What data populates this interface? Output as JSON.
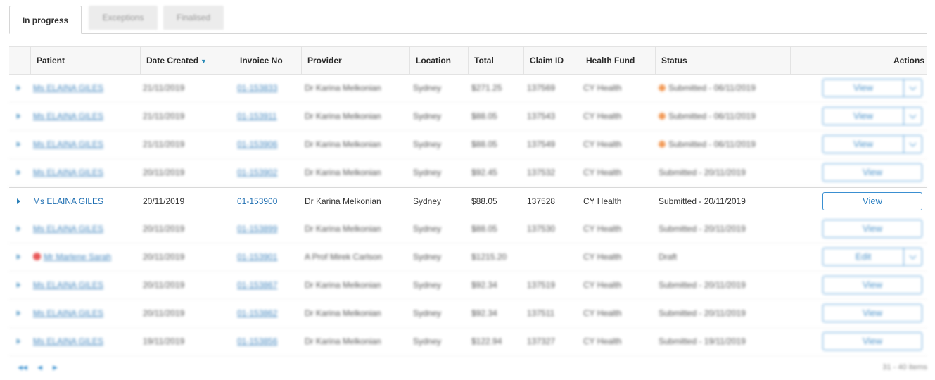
{
  "tabs": [
    {
      "label": "In progress",
      "active": true
    },
    {
      "label": "Exceptions",
      "active": false
    },
    {
      "label": "Finalised",
      "active": false
    }
  ],
  "columns": {
    "patient": "Patient",
    "date_created": "Date Created",
    "invoice_no": "Invoice No",
    "provider": "Provider",
    "location": "Location",
    "total": "Total",
    "claim_id": "Claim ID",
    "health_fund": "Health Fund",
    "status": "Status",
    "actions": "Actions"
  },
  "sort": {
    "column": "date_created",
    "direction": "descending"
  },
  "rows": [
    {
      "patient": "Ms ELAINA GILES",
      "date": "21/11/2019",
      "invoice": "01-153833",
      "provider": "Dr Karina Melkonian",
      "location": "Sydney",
      "total": "$271.25",
      "claim": "137569",
      "fund": "CY Health",
      "status": "Submitted - 06/11/2019",
      "status_dot": "orange",
      "patient_dot": "",
      "action": "View",
      "has_split": true,
      "blurred": true
    },
    {
      "patient": "Ms ELAINA GILES",
      "date": "21/11/2019",
      "invoice": "01-153911",
      "provider": "Dr Karina Melkonian",
      "location": "Sydney",
      "total": "$88.05",
      "claim": "137543",
      "fund": "CY Health",
      "status": "Submitted - 06/11/2019",
      "status_dot": "orange",
      "patient_dot": "",
      "action": "View",
      "has_split": true,
      "blurred": true
    },
    {
      "patient": "Ms ELAINA GILES",
      "date": "21/11/2019",
      "invoice": "01-153906",
      "provider": "Dr Karina Melkonian",
      "location": "Sydney",
      "total": "$88.05",
      "claim": "137549",
      "fund": "CY Health",
      "status": "Submitted - 06/11/2019",
      "status_dot": "orange",
      "patient_dot": "",
      "action": "View",
      "has_split": true,
      "blurred": true
    },
    {
      "patient": "Ms ELAINA GILES",
      "date": "20/11/2019",
      "invoice": "01-153902",
      "provider": "Dr Karina Melkonian",
      "location": "Sydney",
      "total": "$92.45",
      "claim": "137532",
      "fund": "CY Health",
      "status": "Submitted - 20/11/2019",
      "status_dot": "",
      "patient_dot": "",
      "action": "View",
      "has_split": false,
      "blurred": true
    },
    {
      "patient": "Ms ELAINA GILES",
      "date": "20/11/2019",
      "invoice": "01-153900",
      "provider": "Dr Karina Melkonian",
      "location": "Sydney",
      "total": "$88.05",
      "claim": "137528",
      "fund": "CY Health",
      "status": "Submitted - 20/11/2019",
      "status_dot": "",
      "patient_dot": "",
      "action": "View",
      "has_split": false,
      "blurred": false
    },
    {
      "patient": "Ms ELAINA GILES",
      "date": "20/11/2019",
      "invoice": "01-153899",
      "provider": "Dr Karina Melkonian",
      "location": "Sydney",
      "total": "$88.05",
      "claim": "137530",
      "fund": "CY Health",
      "status": "Submitted - 20/11/2019",
      "status_dot": "",
      "patient_dot": "",
      "action": "View",
      "has_split": false,
      "blurred": true
    },
    {
      "patient": "Mr Marlene Sarah",
      "date": "20/11/2019",
      "invoice": "01-153901",
      "provider": "A Prof Mirek Carlson",
      "location": "Sydney",
      "total": "$1215.20",
      "claim": "",
      "fund": "CY Health",
      "status": "Draft",
      "status_dot": "",
      "patient_dot": "red",
      "action": "Edit",
      "has_split": true,
      "blurred": true
    },
    {
      "patient": "Ms ELAINA GILES",
      "date": "20/11/2019",
      "invoice": "01-153867",
      "provider": "Dr Karina Melkonian",
      "location": "Sydney",
      "total": "$92.34",
      "claim": "137519",
      "fund": "CY Health",
      "status": "Submitted - 20/11/2019",
      "status_dot": "",
      "patient_dot": "",
      "action": "View",
      "has_split": false,
      "blurred": true
    },
    {
      "patient": "Ms ELAINA GILES",
      "date": "20/11/2019",
      "invoice": "01-153862",
      "provider": "Dr Karina Melkonian",
      "location": "Sydney",
      "total": "$92.34",
      "claim": "137511",
      "fund": "CY Health",
      "status": "Submitted - 20/11/2019",
      "status_dot": "",
      "patient_dot": "",
      "action": "View",
      "has_split": false,
      "blurred": true
    },
    {
      "patient": "Ms ELAINA GILES",
      "date": "19/11/2019",
      "invoice": "01-153856",
      "provider": "Dr Karina Melkonian",
      "location": "Sydney",
      "total": "$122.94",
      "claim": "137327",
      "fund": "CY Health",
      "status": "Submitted - 19/11/2019",
      "status_dot": "",
      "patient_dot": "",
      "action": "View",
      "has_split": false,
      "blurred": true
    }
  ],
  "pager": {
    "info": "31 - 40 items"
  },
  "colors": {
    "link": "#1f6fb2",
    "button_border": "#3a8fd1",
    "status_orange": "#f08a3c",
    "flag_red": "#e53a3a"
  }
}
